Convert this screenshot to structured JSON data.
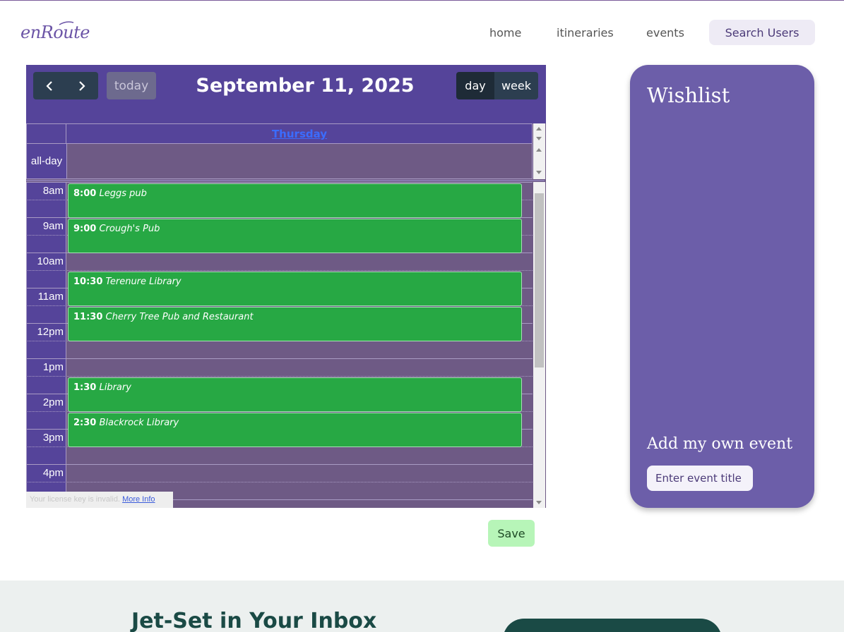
{
  "header": {
    "logo": "enRoute",
    "nav": {
      "home": "home",
      "itineraries": "itineraries",
      "events": "events"
    },
    "search_users": "Search Users"
  },
  "calendar": {
    "title": "September 11, 2025",
    "today_label": "today",
    "view_day": "day",
    "view_week": "week",
    "day_header": "Thursday",
    "allday_label": "all-day",
    "time_labels": [
      "8am",
      "9am",
      "10am",
      "11am",
      "12pm",
      "1pm",
      "2pm",
      "3pm",
      "4pm"
    ],
    "events": [
      {
        "time": "8:00",
        "title": "Leggs pub"
      },
      {
        "time": "9:00",
        "title": "Crough's Pub"
      },
      {
        "time": "10:30",
        "title": "Terenure Library"
      },
      {
        "time": "11:30",
        "title": "Cherry Tree Pub and Restaurant"
      },
      {
        "time": "1:30",
        "title": "Library"
      },
      {
        "time": "2:30",
        "title": "Blackrock Library"
      }
    ],
    "license_text": "Your license key is invalid.",
    "license_link": "More Info"
  },
  "save_label": "Save",
  "wishlist": {
    "title": "Wishlist",
    "add_own_event": "Add my own event",
    "input_placeholder": "Enter event title"
  },
  "footer": {
    "title": "Jet-Set in Your Inbox"
  },
  "colors": {
    "accent": "#55449a",
    "event_green": "#27a844",
    "wishlist": "#6c5ea9"
  }
}
